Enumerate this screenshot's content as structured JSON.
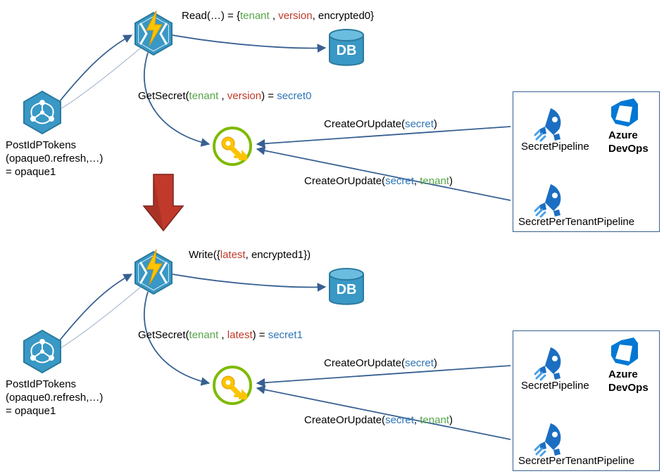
{
  "top": {
    "readLabel": {
      "pre": "Read(…) = {",
      "tenant": "tenant",
      "sep1": " , ",
      "version": "version",
      "sep2": ", ",
      "enc": "encrypted0",
      "post": "}"
    },
    "getSecretLabel": {
      "fn": "GetSecret(",
      "tenant": "tenant",
      "sep1": " , ",
      "version": "version",
      "close": ") = ",
      "result": "secret0"
    },
    "postIdp": {
      "l1": "PostIdPTokens",
      "l2": "(opaque0.refresh,…)",
      "l3": "= opaque1"
    },
    "createOrUpdate1": {
      "fn": "CreateOrUpdate(",
      "arg": "secret",
      "close": ")"
    },
    "createOrUpdate2": {
      "fn": "CreateOrUpdate(",
      "arg1": "secret",
      "sep": ", ",
      "arg2": "tenant",
      "close": ")"
    },
    "secretPipeline": "SecretPipeline",
    "secretPerTenantPipeline": "SecretPerTenantPipeline",
    "azureDevops": {
      "l1": "Azure",
      "l2": "DevOps"
    }
  },
  "bottom": {
    "writeLabel": {
      "pre": "Write({",
      "latest": "latest",
      "sep": ", ",
      "enc": "encrypted1",
      "post": "})"
    },
    "getSecretLabel": {
      "fn": "GetSecret(",
      "tenant": "tenant",
      "sep1": " , ",
      "version": "latest",
      "close": ") = ",
      "result": "secret1"
    },
    "postIdp": {
      "l1": "PostIdPTokens",
      "l2": "(opaque0.refresh,…)",
      "l3": "= opaque1"
    },
    "createOrUpdate1": {
      "fn": "CreateOrUpdate(",
      "arg": "secret",
      "close": ")"
    },
    "createOrUpdate2": {
      "fn": "CreateOrUpdate(",
      "arg1": "secret",
      "sep": ", ",
      "arg2": "tenant",
      "close": ")"
    },
    "secretPipeline": "SecretPipeline",
    "secretPerTenantPipeline": "SecretPerTenantPipeline",
    "azureDevops": {
      "l1": "Azure",
      "l2": "DevOps"
    }
  },
  "dbLabel": "DB"
}
